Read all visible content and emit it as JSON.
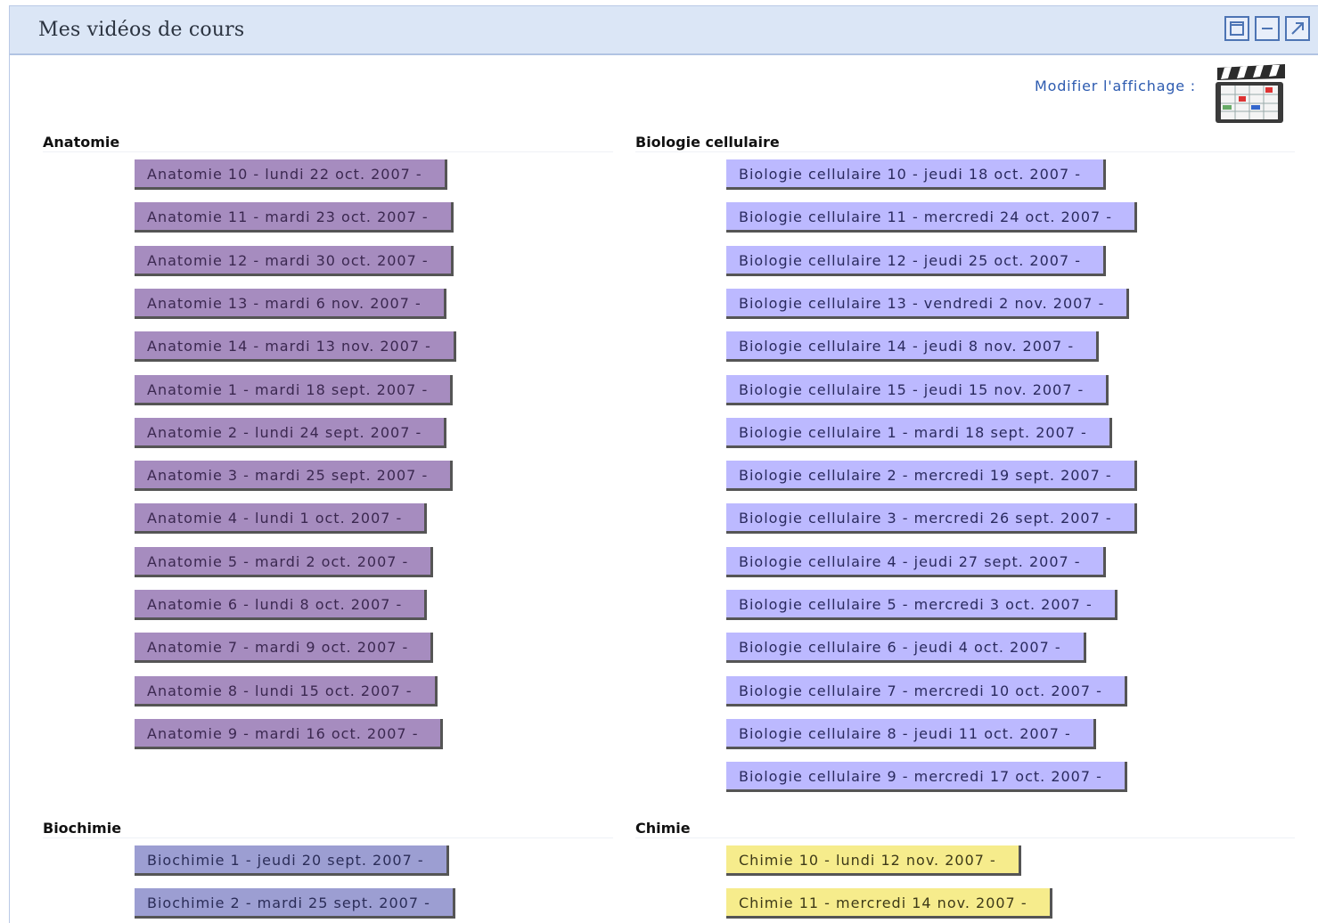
{
  "window": {
    "title": "Mes vidéos de cours"
  },
  "toolbar": {
    "modify_label": "Modifier l'affichage :"
  },
  "icons": {
    "window_restore": "window-restore-icon",
    "window_minimize": "window-minimize-icon",
    "window_maximize": "window-maximize-icon",
    "clapperboard": "clapperboard-calendar-icon"
  },
  "colors": {
    "anatomie": "#a68cbf",
    "biologie_cellulaire": "#bcb9ff",
    "biochimie": "#9c9ed2",
    "chimie": "#f6ec8c",
    "header_bg": "#dbe6f6",
    "link": "#2d5bb0"
  },
  "sections": {
    "anatomie": {
      "title": "Anatomie",
      "items": [
        "Anatomie 10 - lundi 22 oct. 2007 -",
        "Anatomie 11 - mardi 23 oct. 2007 -",
        "Anatomie 12 - mardi 30 oct. 2007 -",
        "Anatomie 13 - mardi 6 nov. 2007 -",
        "Anatomie 14 - mardi 13 nov. 2007 -",
        "Anatomie 1 - mardi 18 sept. 2007 -",
        "Anatomie 2 - lundi 24 sept. 2007 -",
        "Anatomie 3 - mardi 25 sept. 2007 -",
        "Anatomie 4 - lundi 1 oct. 2007 -",
        "Anatomie 5 - mardi 2 oct. 2007 -",
        "Anatomie 6 - lundi 8 oct. 2007 -",
        "Anatomie 7 - mardi 9 oct. 2007 -",
        "Anatomie 8 - lundi 15 oct. 2007 -",
        "Anatomie 9 - mardi 16 oct. 2007 -"
      ]
    },
    "biologie": {
      "title": "Biologie cellulaire",
      "items": [
        "Biologie cellulaire 10 - jeudi 18 oct. 2007 -",
        "Biologie cellulaire 11 - mercredi 24 oct. 2007 -",
        "Biologie cellulaire 12 - jeudi 25 oct. 2007 -",
        "Biologie cellulaire 13 - vendredi 2 nov. 2007 -",
        "Biologie cellulaire 14 - jeudi 8 nov. 2007 -",
        "Biologie cellulaire 15 - jeudi 15 nov. 2007 -",
        "Biologie cellulaire 1 - mardi 18 sept. 2007 -",
        "Biologie cellulaire 2 - mercredi 19 sept. 2007 -",
        "Biologie cellulaire 3 - mercredi 26 sept. 2007 -",
        "Biologie cellulaire 4 - jeudi 27 sept. 2007 -",
        "Biologie cellulaire 5 - mercredi 3 oct. 2007 -",
        "Biologie cellulaire 6 - jeudi 4 oct. 2007 -",
        "Biologie cellulaire 7 - mercredi 10 oct. 2007 -",
        "Biologie cellulaire 8 - jeudi 11 oct. 2007 -",
        "Biologie cellulaire 9 - mercredi 17 oct. 2007 -"
      ]
    },
    "biochimie": {
      "title": "Biochimie",
      "items": [
        "Biochimie 1 - jeudi 20 sept. 2007 -",
        "Biochimie 2 - mardi 25 sept. 2007 -"
      ]
    },
    "chimie": {
      "title": "Chimie",
      "items": [
        "Chimie 10 - lundi 12 nov. 2007 -",
        "Chimie 11 - mercredi 14 nov. 2007 -"
      ]
    }
  }
}
